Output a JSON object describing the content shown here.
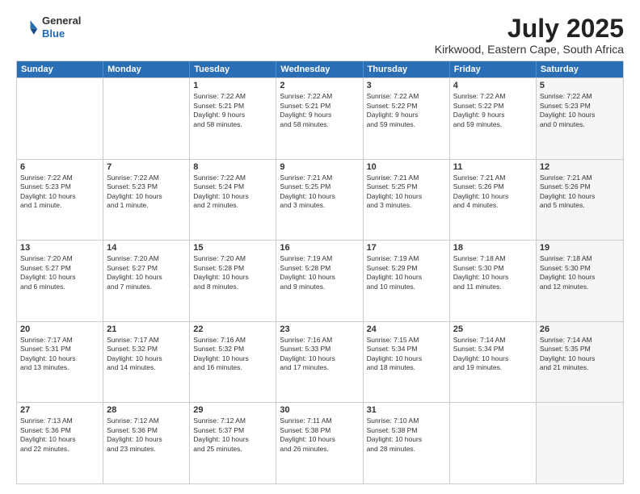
{
  "header": {
    "logo_general": "General",
    "logo_blue": "Blue",
    "month_year": "July 2025",
    "location": "Kirkwood, Eastern Cape, South Africa"
  },
  "days_of_week": [
    "Sunday",
    "Monday",
    "Tuesday",
    "Wednesday",
    "Thursday",
    "Friday",
    "Saturday"
  ],
  "weeks": [
    [
      {
        "day": "",
        "empty": true
      },
      {
        "day": "",
        "empty": true
      },
      {
        "day": "1",
        "lines": [
          "Sunrise: 7:22 AM",
          "Sunset: 5:21 PM",
          "Daylight: 9 hours",
          "and 58 minutes."
        ]
      },
      {
        "day": "2",
        "lines": [
          "Sunrise: 7:22 AM",
          "Sunset: 5:21 PM",
          "Daylight: 9 hours",
          "and 58 minutes."
        ]
      },
      {
        "day": "3",
        "lines": [
          "Sunrise: 7:22 AM",
          "Sunset: 5:22 PM",
          "Daylight: 9 hours",
          "and 59 minutes."
        ]
      },
      {
        "day": "4",
        "lines": [
          "Sunrise: 7:22 AM",
          "Sunset: 5:22 PM",
          "Daylight: 9 hours",
          "and 59 minutes."
        ]
      },
      {
        "day": "5",
        "lines": [
          "Sunrise: 7:22 AM",
          "Sunset: 5:23 PM",
          "Daylight: 10 hours",
          "and 0 minutes."
        ],
        "shaded": true
      }
    ],
    [
      {
        "day": "6",
        "lines": [
          "Sunrise: 7:22 AM",
          "Sunset: 5:23 PM",
          "Daylight: 10 hours",
          "and 1 minute."
        ]
      },
      {
        "day": "7",
        "lines": [
          "Sunrise: 7:22 AM",
          "Sunset: 5:23 PM",
          "Daylight: 10 hours",
          "and 1 minute."
        ]
      },
      {
        "day": "8",
        "lines": [
          "Sunrise: 7:22 AM",
          "Sunset: 5:24 PM",
          "Daylight: 10 hours",
          "and 2 minutes."
        ]
      },
      {
        "day": "9",
        "lines": [
          "Sunrise: 7:21 AM",
          "Sunset: 5:25 PM",
          "Daylight: 10 hours",
          "and 3 minutes."
        ]
      },
      {
        "day": "10",
        "lines": [
          "Sunrise: 7:21 AM",
          "Sunset: 5:25 PM",
          "Daylight: 10 hours",
          "and 3 minutes."
        ]
      },
      {
        "day": "11",
        "lines": [
          "Sunrise: 7:21 AM",
          "Sunset: 5:26 PM",
          "Daylight: 10 hours",
          "and 4 minutes."
        ]
      },
      {
        "day": "12",
        "lines": [
          "Sunrise: 7:21 AM",
          "Sunset: 5:26 PM",
          "Daylight: 10 hours",
          "and 5 minutes."
        ],
        "shaded": true
      }
    ],
    [
      {
        "day": "13",
        "lines": [
          "Sunrise: 7:20 AM",
          "Sunset: 5:27 PM",
          "Daylight: 10 hours",
          "and 6 minutes."
        ]
      },
      {
        "day": "14",
        "lines": [
          "Sunrise: 7:20 AM",
          "Sunset: 5:27 PM",
          "Daylight: 10 hours",
          "and 7 minutes."
        ]
      },
      {
        "day": "15",
        "lines": [
          "Sunrise: 7:20 AM",
          "Sunset: 5:28 PM",
          "Daylight: 10 hours",
          "and 8 minutes."
        ]
      },
      {
        "day": "16",
        "lines": [
          "Sunrise: 7:19 AM",
          "Sunset: 5:28 PM",
          "Daylight: 10 hours",
          "and 9 minutes."
        ]
      },
      {
        "day": "17",
        "lines": [
          "Sunrise: 7:19 AM",
          "Sunset: 5:29 PM",
          "Daylight: 10 hours",
          "and 10 minutes."
        ]
      },
      {
        "day": "18",
        "lines": [
          "Sunrise: 7:18 AM",
          "Sunset: 5:30 PM",
          "Daylight: 10 hours",
          "and 11 minutes."
        ]
      },
      {
        "day": "19",
        "lines": [
          "Sunrise: 7:18 AM",
          "Sunset: 5:30 PM",
          "Daylight: 10 hours",
          "and 12 minutes."
        ],
        "shaded": true
      }
    ],
    [
      {
        "day": "20",
        "lines": [
          "Sunrise: 7:17 AM",
          "Sunset: 5:31 PM",
          "Daylight: 10 hours",
          "and 13 minutes."
        ]
      },
      {
        "day": "21",
        "lines": [
          "Sunrise: 7:17 AM",
          "Sunset: 5:32 PM",
          "Daylight: 10 hours",
          "and 14 minutes."
        ]
      },
      {
        "day": "22",
        "lines": [
          "Sunrise: 7:16 AM",
          "Sunset: 5:32 PM",
          "Daylight: 10 hours",
          "and 16 minutes."
        ]
      },
      {
        "day": "23",
        "lines": [
          "Sunrise: 7:16 AM",
          "Sunset: 5:33 PM",
          "Daylight: 10 hours",
          "and 17 minutes."
        ]
      },
      {
        "day": "24",
        "lines": [
          "Sunrise: 7:15 AM",
          "Sunset: 5:34 PM",
          "Daylight: 10 hours",
          "and 18 minutes."
        ]
      },
      {
        "day": "25",
        "lines": [
          "Sunrise: 7:14 AM",
          "Sunset: 5:34 PM",
          "Daylight: 10 hours",
          "and 19 minutes."
        ]
      },
      {
        "day": "26",
        "lines": [
          "Sunrise: 7:14 AM",
          "Sunset: 5:35 PM",
          "Daylight: 10 hours",
          "and 21 minutes."
        ],
        "shaded": true
      }
    ],
    [
      {
        "day": "27",
        "lines": [
          "Sunrise: 7:13 AM",
          "Sunset: 5:36 PM",
          "Daylight: 10 hours",
          "and 22 minutes."
        ]
      },
      {
        "day": "28",
        "lines": [
          "Sunrise: 7:12 AM",
          "Sunset: 5:36 PM",
          "Daylight: 10 hours",
          "and 23 minutes."
        ]
      },
      {
        "day": "29",
        "lines": [
          "Sunrise: 7:12 AM",
          "Sunset: 5:37 PM",
          "Daylight: 10 hours",
          "and 25 minutes."
        ]
      },
      {
        "day": "30",
        "lines": [
          "Sunrise: 7:11 AM",
          "Sunset: 5:38 PM",
          "Daylight: 10 hours",
          "and 26 minutes."
        ]
      },
      {
        "day": "31",
        "lines": [
          "Sunrise: 7:10 AM",
          "Sunset: 5:38 PM",
          "Daylight: 10 hours",
          "and 28 minutes."
        ]
      },
      {
        "day": "",
        "empty": true
      },
      {
        "day": "",
        "empty": true,
        "shaded": true
      }
    ]
  ]
}
